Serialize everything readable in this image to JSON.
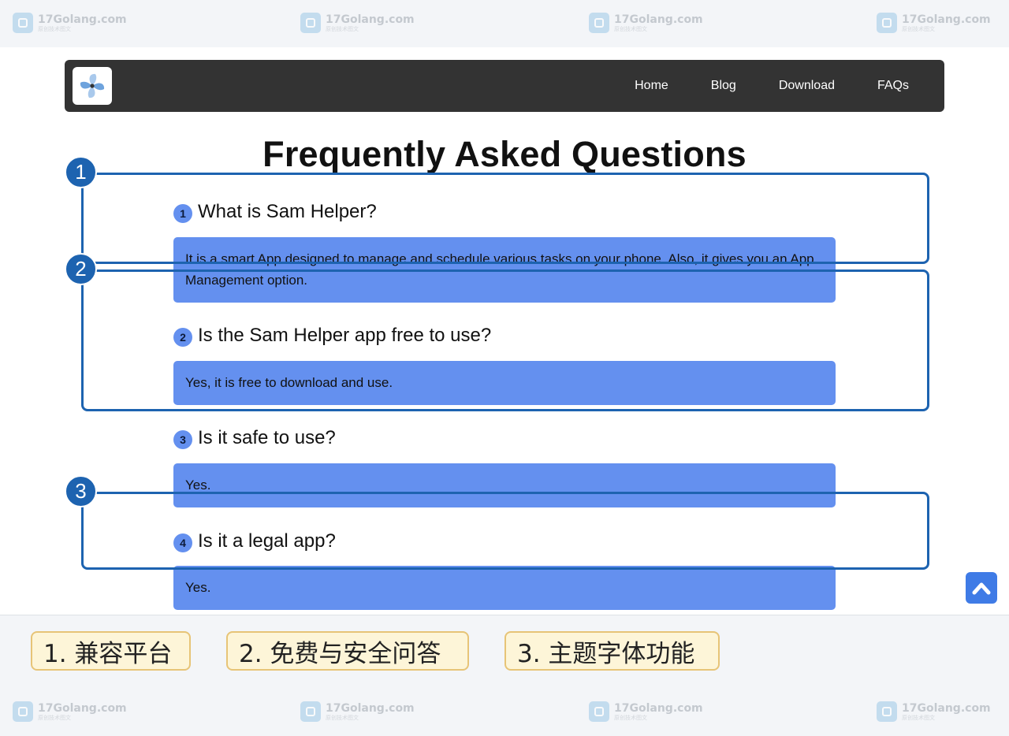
{
  "watermark": {
    "site": "17Golang.com",
    "tagline": "原创技术图文"
  },
  "nav": {
    "links": [
      "Home",
      "Blog",
      "Download",
      "FAQs"
    ]
  },
  "page_title": "Frequently Asked Questions",
  "faqs": [
    {
      "num": "1",
      "question": "What is Sam Helper?",
      "answer": "It is a smart App designed to manage and schedule various tasks on your phone. Also, it gives you an App Management option."
    },
    {
      "num": "2",
      "question": "Is the Sam Helper app free to use?",
      "answer": "Yes, it is free to download and use."
    },
    {
      "num": "3",
      "question": "Is it safe to use?",
      "answer": "Yes."
    },
    {
      "num": "4",
      "question": "Is it a legal app?",
      "answer": "Yes."
    }
  ],
  "annotations": [
    {
      "num": "1",
      "label": "1. 兼容平台"
    },
    {
      "num": "2",
      "label": "2. 免费与安全问答"
    },
    {
      "num": "3",
      "label": "3. 主题字体功能"
    }
  ],
  "colors": {
    "nav_bg": "#333333",
    "answer_bg": "#6490ef",
    "annotation": "#1d63b0",
    "legend_bg": "#fdf5d8",
    "legend_border": "#e7c477"
  },
  "icons": {
    "logo": "pinwheel-logo-icon",
    "scroll_top": "chevron-up-icon",
    "watermark": "watermark-logo-icon"
  }
}
